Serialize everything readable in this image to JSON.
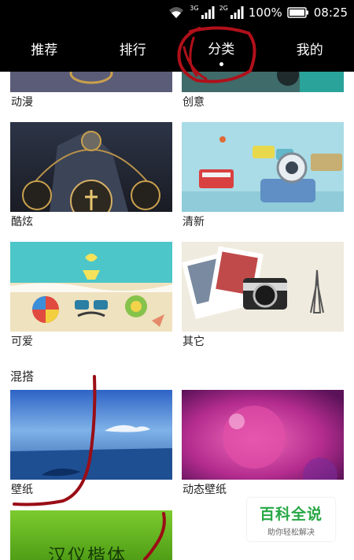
{
  "status_bar": {
    "network_1": "3G",
    "network_2": "2G",
    "battery": "100%",
    "time": "08:25",
    "icons": [
      "wifi-icon",
      "signal-icon",
      "signal-icon",
      "battery-icon"
    ]
  },
  "tabs": [
    {
      "label": "推荐",
      "active": false
    },
    {
      "label": "排行",
      "active": false
    },
    {
      "label": "分类",
      "active": true
    },
    {
      "label": "我的",
      "active": false
    }
  ],
  "categories": {
    "row1": [
      {
        "label": "动漫"
      },
      {
        "label": "创意"
      }
    ],
    "row2": [
      {
        "label": "酷炫"
      },
      {
        "label": "清新"
      }
    ],
    "row3": [
      {
        "label": "可爱"
      },
      {
        "label": "其它"
      }
    ]
  },
  "mix_section": {
    "title": "混搭",
    "items": [
      {
        "label": "壁纸"
      },
      {
        "label": "动态壁纸"
      },
      {
        "label": "汉仪楷体"
      }
    ]
  },
  "watermark": {
    "title": "百科全说",
    "subtitle": "助你轻松解决"
  },
  "colors": {
    "header_bg": "#000000",
    "annotation_red": "#b0101a",
    "watermark_green": "#27a745"
  }
}
